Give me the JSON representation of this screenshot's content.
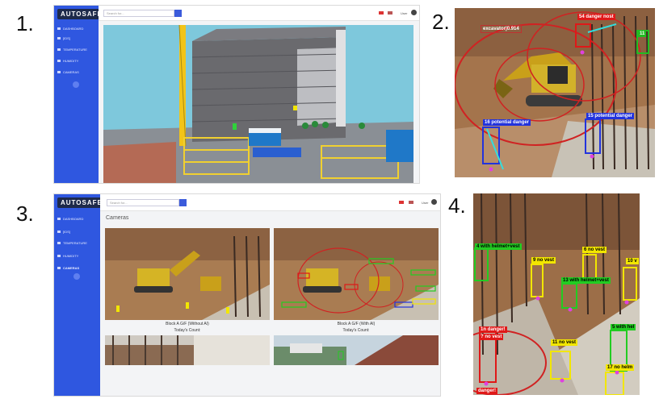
{
  "panel_numbers": [
    "1.",
    "2.",
    "3.",
    "4."
  ],
  "app": {
    "logo": "AUTOSAFE",
    "nav": [
      "DASHBOARD",
      "[IDS]",
      "TEMPERATURE",
      "HUMIDITY",
      "CAMERAS"
    ],
    "search_placeholder": "Search for...",
    "user_label": "User"
  },
  "cameras_page": {
    "title": "Cameras",
    "feeds": [
      {
        "caption": "Block A G/F (Without AI)",
        "count_label": "Today's Count:"
      },
      {
        "caption": "Block A G/F (With AI)",
        "count_label": "Today's Count:"
      }
    ]
  },
  "detections_panel2": [
    {
      "text": "excavator|0.914",
      "color": "#c03030"
    },
    {
      "text": "54 danger nost",
      "color": "#e01818"
    },
    {
      "text": "16 potential danger",
      "color": "#2233dd"
    },
    {
      "text": "15 potential danger",
      "color": "#2233dd"
    },
    {
      "text": "11",
      "color": "#22bb22"
    }
  ],
  "detections_panel4": [
    {
      "text": "4 with helmet+vest",
      "color": "#22cc22",
      "fg": "#000"
    },
    {
      "text": "6 no vest",
      "color": "#f2e600",
      "fg": "#000"
    },
    {
      "text": "9 no vest",
      "color": "#f2e600",
      "fg": "#000"
    },
    {
      "text": "10 v",
      "color": "#f2e600",
      "fg": "#000"
    },
    {
      "text": "13 with helmet+vest",
      "color": "#22cc22",
      "fg": "#000"
    },
    {
      "text": "5 with hel",
      "color": "#22cc22",
      "fg": "#000"
    },
    {
      "text": "1n danger!",
      "color": "#e01818",
      "fg": "#fff"
    },
    {
      "text": "? no vest",
      "color": "#e01818",
      "fg": "#fff"
    },
    {
      "text": "11 no vest",
      "color": "#f2e600",
      "fg": "#000"
    },
    {
      "text": "17 no helm",
      "color": "#f2e600",
      "fg": "#000"
    },
    {
      "text": "danger!",
      "color": "#e01818",
      "fg": "#fff"
    }
  ]
}
